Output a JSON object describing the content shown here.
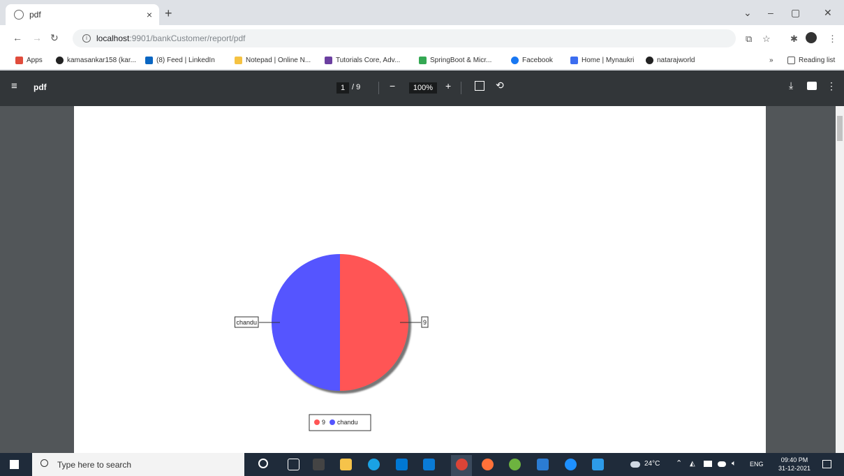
{
  "browser": {
    "tab_title": "pdf",
    "url_host": "localhost",
    "url_path": ":9901/bankCustomer/report/pdf",
    "bookmarks": [
      {
        "label": "Apps",
        "color": "#e04c3c"
      },
      {
        "label": "kamasankar158 (kar...",
        "color": "#222222"
      },
      {
        "label": "(8) Feed | LinkedIn",
        "color": "#0a66c2"
      },
      {
        "label": "Notepad | Online N...",
        "color": "#f5c242"
      },
      {
        "label": "Tutorials Core, Adv...",
        "color": "#6b3fa0"
      },
      {
        "label": "SpringBoot & Micr...",
        "color": "#34a853"
      },
      {
        "label": "Facebook",
        "color": "#1877f2"
      },
      {
        "label": "Home | Mynaukri",
        "color": "#3c6df0"
      },
      {
        "label": "natarajworld",
        "color": "#222222"
      }
    ],
    "reading_list": "Reading list"
  },
  "pdf_toolbar": {
    "title": "pdf",
    "page_current": "1",
    "page_total": "/ 9",
    "zoom": "100%"
  },
  "chart_data": {
    "type": "pie",
    "slices": [
      {
        "label": "9",
        "value": 50,
        "color": "#ff5555"
      },
      {
        "label": "chandu",
        "value": 50,
        "color": "#5555ff"
      }
    ],
    "legend": [
      "9",
      "chandu"
    ]
  },
  "taskbar": {
    "search_placeholder": "Type here to search",
    "weather": "24°C",
    "language": "ENG",
    "time": "09:40 PM",
    "date": "31-12-2021"
  }
}
